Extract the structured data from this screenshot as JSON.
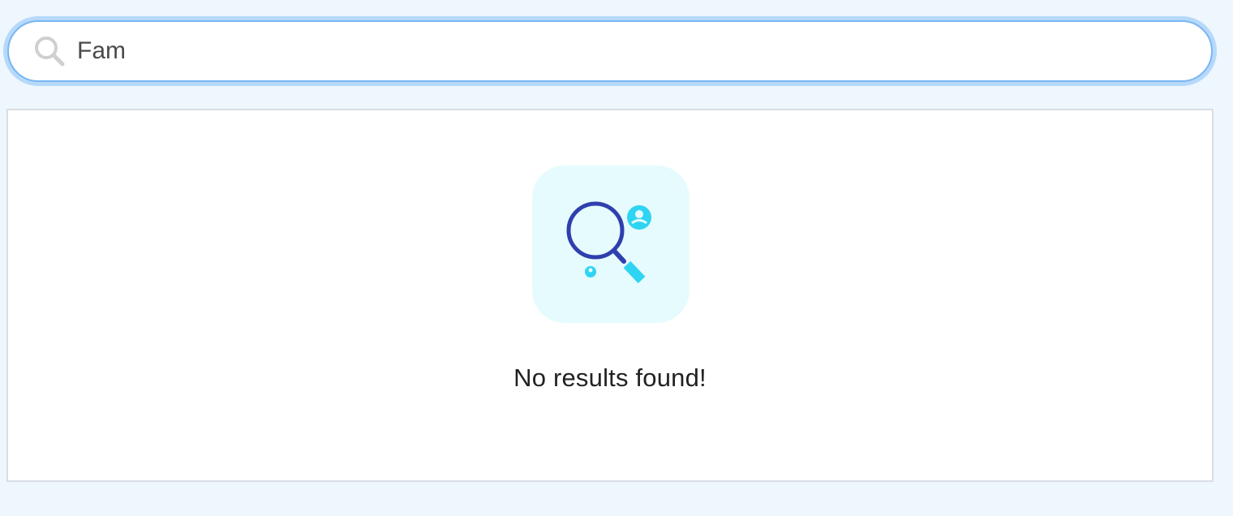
{
  "search": {
    "value": "Fam",
    "icon": "search-icon"
  },
  "results": {
    "empty_message": "No results found!",
    "illustration_icon": "no-results-illustration-icon"
  },
  "colors": {
    "page_background": "#eef6fe",
    "focus_ring": "#b6d9fb",
    "input_border": "#79b6f2",
    "illustration_background": "#e6fbfd",
    "magnifier_blue": "#2f3fae",
    "accent_cyan": "#2fd4f2"
  }
}
